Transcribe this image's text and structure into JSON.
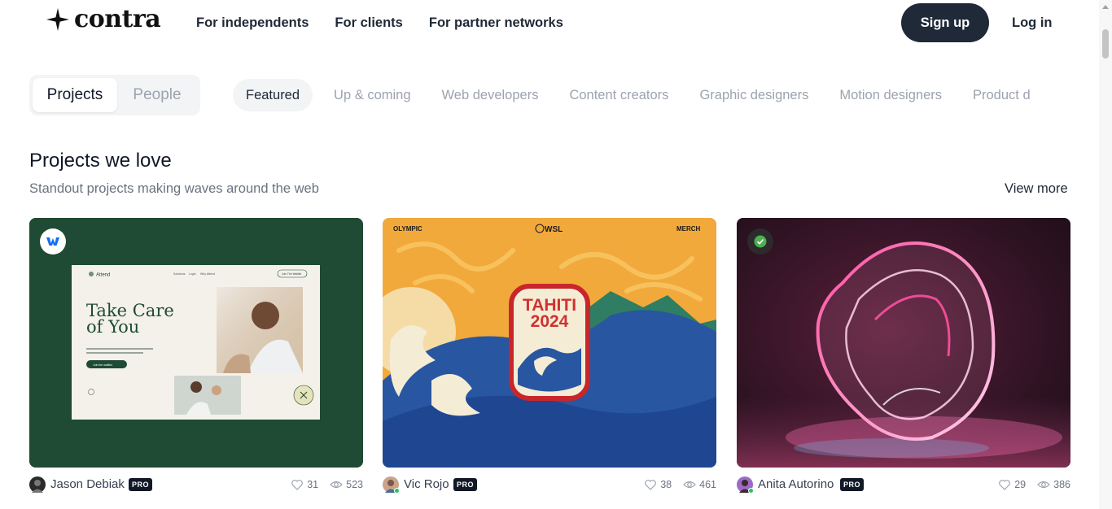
{
  "header": {
    "logo_text": "contra",
    "nav": [
      "For independents",
      "For clients",
      "For partner networks"
    ],
    "signup_label": "Sign up",
    "login_label": "Log in"
  },
  "filters": {
    "toggle": [
      "Projects",
      "People"
    ],
    "categories": [
      "Featured",
      "Up & coming",
      "Web developers",
      "Content creators",
      "Graphic designers",
      "Motion designers",
      "Product d"
    ]
  },
  "section": {
    "title": "Projects we love",
    "subtitle": "Standout projects making waves around the web",
    "view_more": "View more"
  },
  "cards": [
    {
      "author": "Jason Debiak",
      "pro": "PRO",
      "likes": "31",
      "views": "523",
      "thumb": {
        "site_name": "Attend",
        "headline_1": "Take Care",
        "headline_2": "of You",
        "cta": "Join the waitlist",
        "nav_1": "Solutions",
        "nav_2": "Login",
        "nav_3": "Why Attend",
        "nav_btn": "Join The Waitlist"
      },
      "bg": "#1f4a33"
    },
    {
      "author": "Vic Rojo",
      "pro": "PRO",
      "likes": "38",
      "views": "461",
      "thumb": {
        "top_left": "OLYMPIC",
        "top_center": "WSL",
        "top_right": "MERCH",
        "badge_1": "TAHITI",
        "badge_2": "2024"
      },
      "bg": "#f2a93b"
    },
    {
      "author": "Anita Autorino",
      "pro": "PRO",
      "likes": "29",
      "views": "386",
      "bg": "#3a1628"
    }
  ],
  "colors": {
    "accent_dark": "#1f2937",
    "muted": "#9ca3af",
    "webflow_blue": "#146ef5",
    "verified_green": "#4caf50"
  }
}
